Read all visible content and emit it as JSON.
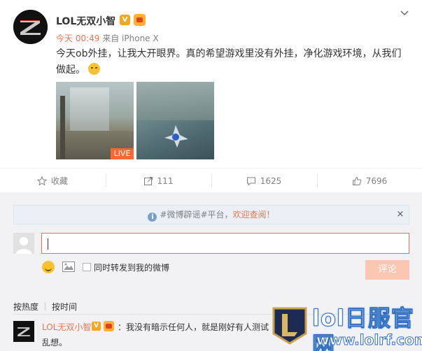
{
  "post": {
    "username": "LOL无双小智",
    "v_badge": "V",
    "time": "今天 00:49",
    "source": "来自 iPhone X",
    "text": "今天ob外挂，让我大开眼界。真的希望游戏里没有外挂，净化游戏环境，从我们做起。",
    "live_label": "LIVE"
  },
  "actions": {
    "favorite": "收藏",
    "repost_count": "111",
    "comment_count": "1625",
    "like_count": "7696"
  },
  "notice": {
    "prefix": "#微博辟谣#平台，",
    "highlight": "欢迎查阅！"
  },
  "composer": {
    "repost_label": "同时转发到我的微博",
    "submit_label": "评论"
  },
  "sort": {
    "by_heat": "按热度",
    "by_time": "按时间"
  },
  "comment": {
    "name": "LOL无双小智",
    "v_badge": "V",
    "text": "：我没有暗示任何人，就是刚好有人测试",
    "text_tail": "乱想。"
  },
  "watermark": {
    "title": "lol日服官网",
    "url": "www.lolrf.com"
  },
  "colors": {
    "accent": "#eb7350",
    "v_badge": "#f5a623",
    "submit_disabled": "#fbc7b3",
    "watermark_stroke": "#2e6fc0"
  }
}
